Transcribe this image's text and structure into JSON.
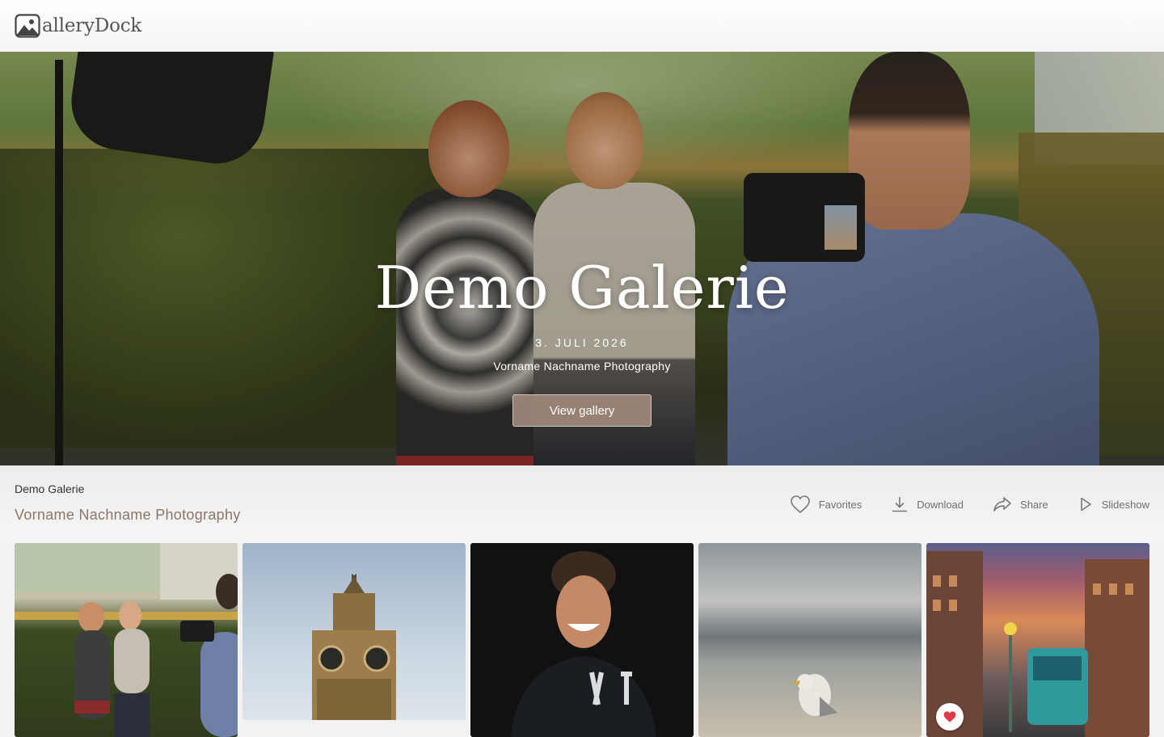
{
  "header": {
    "logo_text": "alleryDock",
    "logo_icon": "image-icon"
  },
  "hero": {
    "title": "Demo Galerie",
    "date": "3. JULI 2026",
    "subtitle": "Vorname Nachname Photography",
    "button_label": "View gallery"
  },
  "info": {
    "title": "Demo Galerie",
    "subtitle": "Vorname Nachname Photography",
    "actions": [
      {
        "label": "Favorites",
        "icon": "heart-icon"
      },
      {
        "label": "Download",
        "icon": "download-icon"
      },
      {
        "label": "Share",
        "icon": "share-icon"
      },
      {
        "label": "Slideshow",
        "icon": "play-icon"
      }
    ]
  },
  "thumbnails": [
    {
      "subject": "photographer with two women"
    },
    {
      "subject": "big ben clock tower"
    },
    {
      "subject": "smiling man portrait"
    },
    {
      "subject": "seagull on beach"
    },
    {
      "subject": "tram in street at sunset",
      "favorited": true
    }
  ],
  "colors": {
    "accent_button": "#9e887a",
    "subtitle_brown": "#8c7667",
    "favorite_red": "#e0394a"
  }
}
